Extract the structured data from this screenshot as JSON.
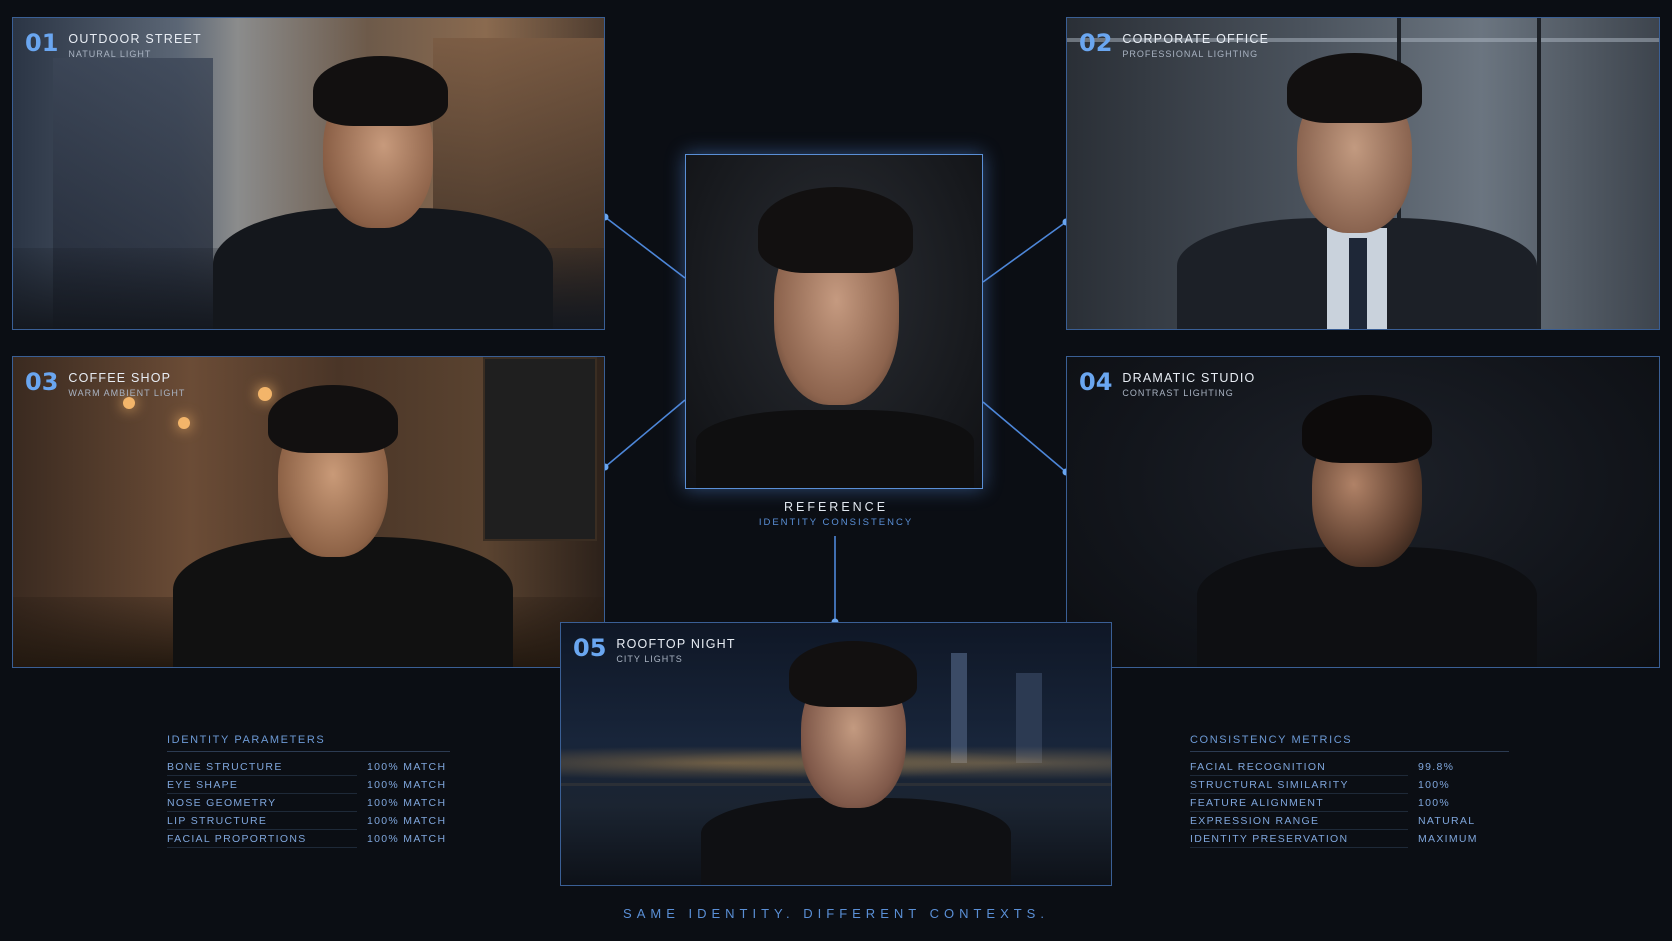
{
  "panels": [
    {
      "num": "01",
      "title": "OUTDOOR STREET",
      "subtitle": "NATURAL LIGHT"
    },
    {
      "num": "02",
      "title": "CORPORATE OFFICE",
      "subtitle": "PROFESSIONAL LIGHTING"
    },
    {
      "num": "03",
      "title": "COFFEE SHOP",
      "subtitle": "WARM AMBIENT LIGHT"
    },
    {
      "num": "04",
      "title": "DRAMATIC STUDIO",
      "subtitle": "CONTRAST LIGHTING"
    },
    {
      "num": "05",
      "title": "ROOFTOP NIGHT",
      "subtitle": "CITY LIGHTS"
    }
  ],
  "reference": {
    "title": "REFERENCE",
    "subtitle": "IDENTITY CONSISTENCY"
  },
  "identity_parameters": {
    "heading": "IDENTITY PARAMETERS",
    "rows": [
      {
        "k": "BONE STRUCTURE",
        "v": "100% MATCH"
      },
      {
        "k": "EYE SHAPE",
        "v": "100% MATCH"
      },
      {
        "k": "NOSE GEOMETRY",
        "v": "100% MATCH"
      },
      {
        "k": "LIP STRUCTURE",
        "v": "100% MATCH"
      },
      {
        "k": "FACIAL PROPORTIONS",
        "v": "100% MATCH"
      }
    ]
  },
  "consistency_metrics": {
    "heading": "CONSISTENCY METRICS",
    "rows": [
      {
        "k": "FACIAL RECOGNITION",
        "v": "99.8%"
      },
      {
        "k": "STRUCTURAL SIMILARITY",
        "v": "100%"
      },
      {
        "k": "FEATURE ALIGNMENT",
        "v": "100%"
      },
      {
        "k": "EXPRESSION RANGE",
        "v": "NATURAL"
      },
      {
        "k": "IDENTITY PRESERVATION",
        "v": "MAXIMUM"
      }
    ]
  },
  "tagline": "SAME IDENTITY. DIFFERENT CONTEXTS.",
  "colors": {
    "accent": "#5a8fd6",
    "background": "#0b0e14",
    "border": "#3a5f95"
  }
}
